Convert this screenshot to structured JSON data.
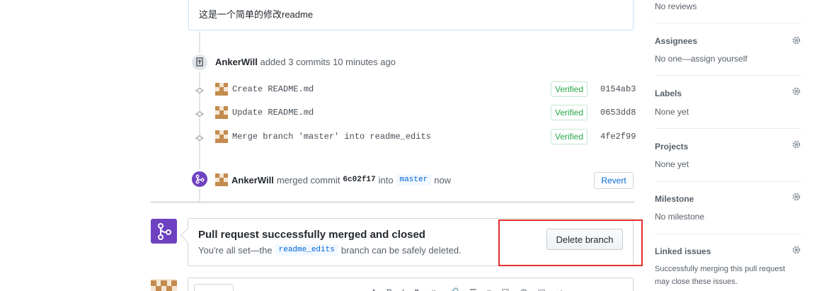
{
  "comment": {
    "text": "这是一个简单的修改readme"
  },
  "push_event": {
    "author": "AnkerWill",
    "action": "added 3 commits 10 minutes ago"
  },
  "commits": [
    {
      "message": "Create README.md",
      "verified": "Verified",
      "sha": "0154ab3"
    },
    {
      "message": "Update README.md",
      "verified": "Verified",
      "sha": "0653dd8"
    },
    {
      "message": "Merge branch 'master' into readme_edits",
      "verified": "Verified",
      "sha": "4fe2f99"
    }
  ],
  "merge_event": {
    "author": "AnkerWill",
    "action": "merged commit",
    "sha": "6c02f17",
    "into": "into",
    "branch": "master",
    "time": "now",
    "revert_label": "Revert"
  },
  "merged_box": {
    "title": "Pull request successfully merged and closed",
    "sub_prefix": "You're all set—the",
    "branch": "readme_edits",
    "sub_suffix": "branch can be safely deleted.",
    "delete_label": "Delete branch"
  },
  "sidebar": {
    "reviewers_value": "No reviews",
    "assignees": {
      "heading": "Assignees",
      "value": "No one—assign yourself"
    },
    "labels": {
      "heading": "Labels",
      "value": "None yet"
    },
    "projects": {
      "heading": "Projects",
      "value": "None yet"
    },
    "milestone": {
      "heading": "Milestone",
      "value": "No milestone"
    },
    "linked_issues": {
      "heading": "Linked issues",
      "value_line1": "Successfully merging this pull request",
      "value_line2": "may close these issues."
    }
  },
  "colors": {
    "merged_purple": "#6f42c1",
    "verified_green": "#28a745",
    "link_blue": "#0366d6",
    "highlight_red": "#e0302c"
  }
}
